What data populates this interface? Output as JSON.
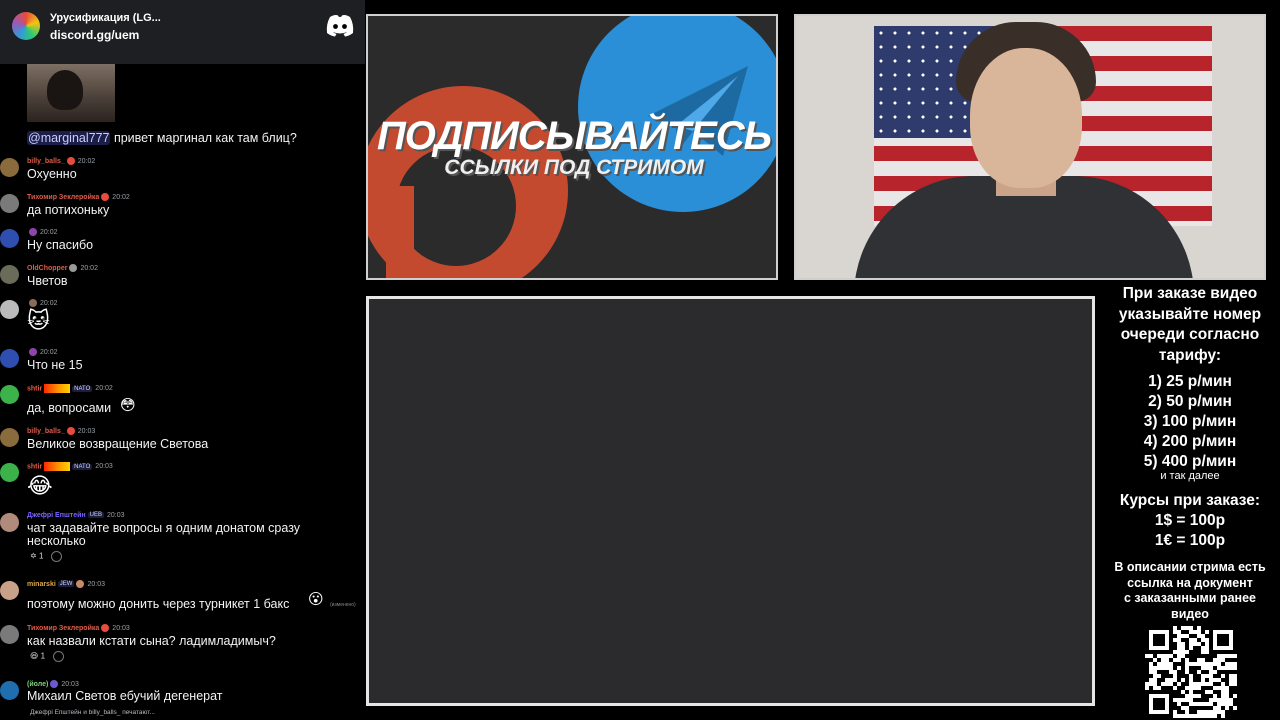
{
  "server": {
    "name": "Урусификация (LG...",
    "invite": "discord.gg/uem",
    "logo_icon": "discord-logo-icon"
  },
  "chat": {
    "messages": [
      {
        "text_mention": "@marginal777",
        "text": " привет маргинал как там блиц?"
      },
      {
        "author": "billy_balls_",
        "time": "20:02",
        "text": "Охуенно",
        "name_color": "#e05c4a"
      },
      {
        "author": "Тихомир Зеклеройка",
        "time": "20:02",
        "text": "да потихоньку",
        "name_color": "#e05c4a"
      },
      {
        "author": "",
        "time": "20:02",
        "text": "Ну спасибо",
        "name_color": "#9b59b6"
      },
      {
        "author": "OldChopper",
        "time": "20:02",
        "text": "Чветов",
        "name_color": "#e05c4a"
      },
      {
        "author": "",
        "time": "20:02",
        "text": "",
        "name_color": "#3a6b3a"
      },
      {
        "author": "",
        "time": "20:02",
        "text": "Что не 15",
        "name_color": "#9b59b6"
      },
      {
        "author": "shtir",
        "tag": "NATO",
        "time": "20:02",
        "text": "да, вопросами",
        "name_color": "#e05c4a"
      },
      {
        "author": "billy_balls_",
        "time": "20:03",
        "text": "Великое возвращение Светова",
        "name_color": "#e05c4a"
      },
      {
        "author": "shtir",
        "tag": "NATO",
        "time": "20:03",
        "text": "",
        "name_color": "#e05c4a"
      },
      {
        "author": "Джефрі Епштейн",
        "tag": "UEB",
        "time": "20:03",
        "text": "чат задавайте вопросы я одним донатом сразу",
        "text2": "несколько",
        "name_color": "#7b61ff",
        "reaction_count": "1"
      },
      {
        "author": "minarski",
        "tag": "JEW",
        "time": "20:03",
        "text": "поэтому можно донить через турникет 1 бакс",
        "edited": "(изменено)",
        "name_color": "#e0a84a"
      },
      {
        "author": "Тихомир Зеклеройка",
        "time": "20:03",
        "text": "как назвали кстати сына? ладимладимыч?",
        "name_color": "#e05c4a",
        "reaction_count": "1"
      },
      {
        "author": "(йоле)",
        "time": "20:03",
        "text": "Михаил Светов ебучий дегенерат",
        "name_color": "#7fd37f"
      }
    ],
    "typing": "Джефрі Епштейн и billy_balls_ печатают..."
  },
  "banner": {
    "headline": "ПОДПИСЫВАЙТЕСЬ",
    "subheadline": "ССЫЛКИ ПОД СТРИМОМ",
    "icons": [
      "patreon-logo-icon",
      "telegram-logo-icon"
    ],
    "colors": {
      "patreon": "#c44a2f",
      "telegram": "#2a8fd6"
    }
  },
  "info": {
    "lines": [
      "При заказе видео",
      "указывайте номер",
      "очереди согласно",
      "тарифу:"
    ],
    "tiers": [
      "1) 25 р/мин",
      "2) 50 р/мин",
      "3) 100 р/мин",
      "4) 200 р/мин",
      "5) 400 р/мин"
    ],
    "etc": "и так далее",
    "rates_title": "Курсы при заказе:",
    "rates": [
      "1$ = 100р",
      "1€ = 100р"
    ],
    "desc": [
      "В описании стрима есть",
      "ссылка на документ",
      "с заказанными ранее",
      "видео"
    ]
  }
}
